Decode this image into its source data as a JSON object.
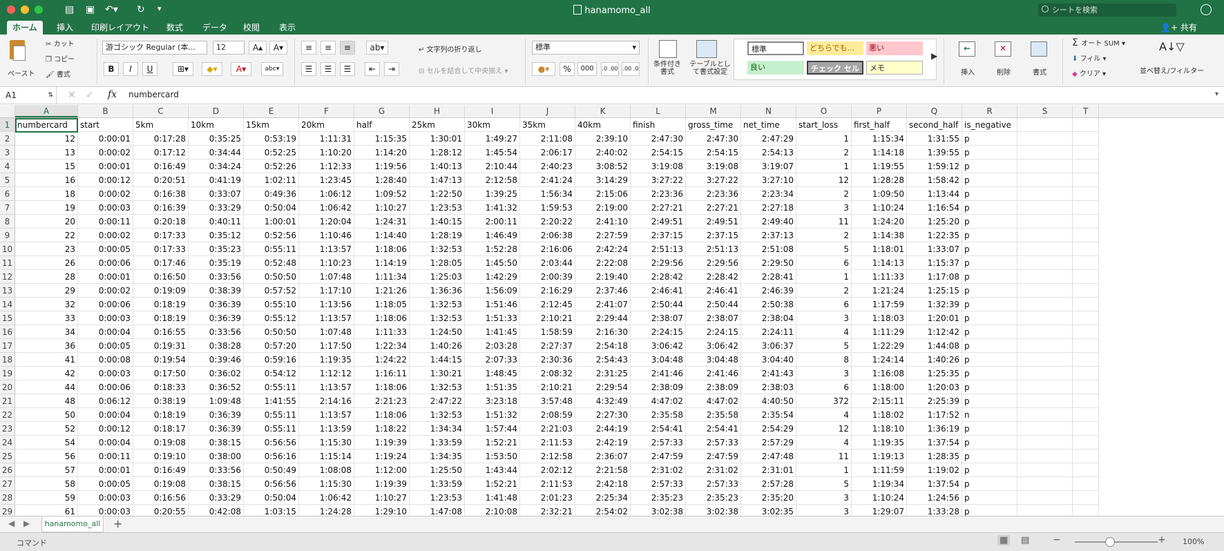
{
  "window": {
    "title": "hanamomo_all"
  },
  "search": {
    "placeholder": "シートを検索"
  },
  "tabs": [
    "ホーム",
    "挿入",
    "印刷レイアウト",
    "数式",
    "データ",
    "校閲",
    "表示"
  ],
  "share_label": "共有",
  "ribbon": {
    "paste": "ペースト",
    "cut": "カット",
    "copy": "コピー",
    "format_painter": "書式",
    "font_name": "游ゴシック Regular (本...",
    "font_size": "12",
    "bold": "B",
    "italic": "I",
    "underline": "U",
    "wrap_text": "文字列の折り返し",
    "merge_center": "セルを結合して中央揃え",
    "number_format": "標準",
    "percent": "%",
    "comma": "000",
    "dec_inc": ".0 .00",
    "dec_dec": ".00 .0",
    "conditional_format": "条件付き\n書式",
    "table_format": "テーブルとして書式設定",
    "styles": [
      "標準",
      "どちらでも...",
      "悪い",
      "良い",
      "チェック セル",
      "メモ"
    ],
    "insert": "挿入",
    "delete": "削除",
    "format": "書式",
    "autosum": "オート SUM",
    "fill": "フィル",
    "clear": "クリア",
    "sort_filter": "並べ替え/フィルター"
  },
  "formula_bar": {
    "name_box": "A1",
    "fx": "fx",
    "value": "numbercard"
  },
  "columns": [
    "A",
    "B",
    "C",
    "D",
    "E",
    "F",
    "G",
    "H",
    "I",
    "J",
    "K",
    "L",
    "M",
    "N",
    "O",
    "P",
    "Q",
    "R",
    "S",
    "T"
  ],
  "row_numbers": [
    1,
    2,
    3,
    4,
    5,
    6,
    7,
    8,
    9,
    10,
    11,
    12,
    13,
    14,
    15,
    16,
    17,
    18,
    19,
    20,
    21,
    22,
    23,
    24,
    25,
    26,
    27,
    28,
    29
  ],
  "headers": [
    "numbercard",
    "start",
    "5km",
    "10km",
    "15km",
    "20km",
    "half",
    "25km",
    "30km",
    "35km",
    "40km",
    "finish",
    "gross_time",
    "net_time",
    "start_loss",
    "first_half",
    "second_half",
    "is_negative"
  ],
  "rows": [
    [
      "12",
      "0:00:01",
      "0:17:28",
      "0:35:25",
      "0:53:19",
      "1:11:31",
      "1:15:35",
      "1:30:01",
      "1:49:27",
      "2:11:08",
      "2:39:10",
      "2:47:30",
      "2:47:30",
      "2:47:29",
      "1",
      "1:15:34",
      "1:31:55",
      "p"
    ],
    [
      "13",
      "0:00:02",
      "0:17:12",
      "0:34:44",
      "0:52:25",
      "1:10:20",
      "1:14:20",
      "1:28:12",
      "1:45:54",
      "2:06:17",
      "2:40:02",
      "2:54:15",
      "2:54:15",
      "2:54:13",
      "2",
      "1:14:18",
      "1:39:55",
      "p"
    ],
    [
      "15",
      "0:00:01",
      "0:16:49",
      "0:34:24",
      "0:52:26",
      "1:12:33",
      "1:19:56",
      "1:40:13",
      "2:10:44",
      "2:40:23",
      "3:08:52",
      "3:19:08",
      "3:19:08",
      "3:19:07",
      "1",
      "1:19:55",
      "1:59:12",
      "p"
    ],
    [
      "16",
      "0:00:12",
      "0:20:51",
      "0:41:19",
      "1:02:11",
      "1:23:45",
      "1:28:40",
      "1:47:13",
      "2:12:58",
      "2:41:24",
      "3:14:29",
      "3:27:22",
      "3:27:22",
      "3:27:10",
      "12",
      "1:28:28",
      "1:58:42",
      "p"
    ],
    [
      "18",
      "0:00:02",
      "0:16:38",
      "0:33:07",
      "0:49:36",
      "1:06:12",
      "1:09:52",
      "1:22:50",
      "1:39:25",
      "1:56:34",
      "2:15:06",
      "2:23:36",
      "2:23:36",
      "2:23:34",
      "2",
      "1:09:50",
      "1:13:44",
      "p"
    ],
    [
      "19",
      "0:00:03",
      "0:16:39",
      "0:33:29",
      "0:50:04",
      "1:06:42",
      "1:10:27",
      "1:23:53",
      "1:41:32",
      "1:59:53",
      "2:19:00",
      "2:27:21",
      "2:27:21",
      "2:27:18",
      "3",
      "1:10:24",
      "1:16:54",
      "p"
    ],
    [
      "20",
      "0:00:11",
      "0:20:18",
      "0:40:11",
      "1:00:01",
      "1:20:04",
      "1:24:31",
      "1:40:15",
      "2:00:11",
      "2:20:22",
      "2:41:10",
      "2:49:51",
      "2:49:51",
      "2:49:40",
      "11",
      "1:24:20",
      "1:25:20",
      "p"
    ],
    [
      "22",
      "0:00:02",
      "0:17:33",
      "0:35:12",
      "0:52:56",
      "1:10:46",
      "1:14:40",
      "1:28:19",
      "1:46:49",
      "2:06:38",
      "2:27:59",
      "2:37:15",
      "2:37:15",
      "2:37:13",
      "2",
      "1:14:38",
      "1:22:35",
      "p"
    ],
    [
      "23",
      "0:00:05",
      "0:17:33",
      "0:35:23",
      "0:55:11",
      "1:13:57",
      "1:18:06",
      "1:32:53",
      "1:52:28",
      "2:16:06",
      "2:42:24",
      "2:51:13",
      "2:51:13",
      "2:51:08",
      "5",
      "1:18:01",
      "1:33:07",
      "p"
    ],
    [
      "26",
      "0:00:06",
      "0:17:46",
      "0:35:19",
      "0:52:48",
      "1:10:23",
      "1:14:19",
      "1:28:05",
      "1:45:50",
      "2:03:44",
      "2:22:08",
      "2:29:56",
      "2:29:56",
      "2:29:50",
      "6",
      "1:14:13",
      "1:15:37",
      "p"
    ],
    [
      "28",
      "0:00:01",
      "0:16:50",
      "0:33:56",
      "0:50:50",
      "1:07:48",
      "1:11:34",
      "1:25:03",
      "1:42:29",
      "2:00:39",
      "2:19:40",
      "2:28:42",
      "2:28:42",
      "2:28:41",
      "1",
      "1:11:33",
      "1:17:08",
      "p"
    ],
    [
      "29",
      "0:00:02",
      "0:19:09",
      "0:38:39",
      "0:57:52",
      "1:17:10",
      "1:21:26",
      "1:36:36",
      "1:56:09",
      "2:16:29",
      "2:37:46",
      "2:46:41",
      "2:46:41",
      "2:46:39",
      "2",
      "1:21:24",
      "1:25:15",
      "p"
    ],
    [
      "32",
      "0:00:06",
      "0:18:19",
      "0:36:39",
      "0:55:10",
      "1:13:56",
      "1:18:05",
      "1:32:53",
      "1:51:46",
      "2:12:45",
      "2:41:07",
      "2:50:44",
      "2:50:44",
      "2:50:38",
      "6",
      "1:17:59",
      "1:32:39",
      "p"
    ],
    [
      "33",
      "0:00:03",
      "0:18:19",
      "0:36:39",
      "0:55:12",
      "1:13:57",
      "1:18:06",
      "1:32:53",
      "1:51:33",
      "2:10:21",
      "2:29:44",
      "2:38:07",
      "2:38:07",
      "2:38:04",
      "3",
      "1:18:03",
      "1:20:01",
      "p"
    ],
    [
      "34",
      "0:00:04",
      "0:16:55",
      "0:33:56",
      "0:50:50",
      "1:07:48",
      "1:11:33",
      "1:24:50",
      "1:41:45",
      "1:58:59",
      "2:16:30",
      "2:24:15",
      "2:24:15",
      "2:24:11",
      "4",
      "1:11:29",
      "1:12:42",
      "p"
    ],
    [
      "36",
      "0:00:05",
      "0:19:31",
      "0:38:28",
      "0:57:20",
      "1:17:50",
      "1:22:34",
      "1:40:26",
      "2:03:28",
      "2:27:37",
      "2:54:18",
      "3:06:42",
      "3:06:42",
      "3:06:37",
      "5",
      "1:22:29",
      "1:44:08",
      "p"
    ],
    [
      "41",
      "0:00:08",
      "0:19:54",
      "0:39:46",
      "0:59:16",
      "1:19:35",
      "1:24:22",
      "1:44:15",
      "2:07:33",
      "2:30:36",
      "2:54:43",
      "3:04:48",
      "3:04:48",
      "3:04:40",
      "8",
      "1:24:14",
      "1:40:26",
      "p"
    ],
    [
      "42",
      "0:00:03",
      "0:17:50",
      "0:36:02",
      "0:54:12",
      "1:12:12",
      "1:16:11",
      "1:30:21",
      "1:48:45",
      "2:08:32",
      "2:31:25",
      "2:41:46",
      "2:41:46",
      "2:41:43",
      "3",
      "1:16:08",
      "1:25:35",
      "p"
    ],
    [
      "44",
      "0:00:06",
      "0:18:33",
      "0:36:52",
      "0:55:11",
      "1:13:57",
      "1:18:06",
      "1:32:53",
      "1:51:35",
      "2:10:21",
      "2:29:54",
      "2:38:09",
      "2:38:09",
      "2:38:03",
      "6",
      "1:18:00",
      "1:20:03",
      "p"
    ],
    [
      "48",
      "0:06:12",
      "0:38:19",
      "1:09:48",
      "1:41:55",
      "2:14:16",
      "2:21:23",
      "2:47:22",
      "3:23:18",
      "3:57:48",
      "4:32:49",
      "4:47:02",
      "4:47:02",
      "4:40:50",
      "372",
      "2:15:11",
      "2:25:39",
      "p"
    ],
    [
      "50",
      "0:00:04",
      "0:18:19",
      "0:36:39",
      "0:55:11",
      "1:13:57",
      "1:18:06",
      "1:32:53",
      "1:51:32",
      "2:08:59",
      "2:27:30",
      "2:35:58",
      "2:35:58",
      "2:35:54",
      "4",
      "1:18:02",
      "1:17:52",
      "n"
    ],
    [
      "52",
      "0:00:12",
      "0:18:17",
      "0:36:39",
      "0:55:11",
      "1:13:59",
      "1:18:22",
      "1:34:34",
      "1:57:44",
      "2:21:03",
      "2:44:19",
      "2:54:41",
      "2:54:41",
      "2:54:29",
      "12",
      "1:18:10",
      "1:36:19",
      "p"
    ],
    [
      "54",
      "0:00:04",
      "0:19:08",
      "0:38:15",
      "0:56:56",
      "1:15:30",
      "1:19:39",
      "1:33:59",
      "1:52:21",
      "2:11:53",
      "2:42:19",
      "2:57:33",
      "2:57:33",
      "2:57:29",
      "4",
      "1:19:35",
      "1:37:54",
      "p"
    ],
    [
      "56",
      "0:00:11",
      "0:19:10",
      "0:38:00",
      "0:56:16",
      "1:15:14",
      "1:19:24",
      "1:34:35",
      "1:53:50",
      "2:12:58",
      "2:36:07",
      "2:47:59",
      "2:47:59",
      "2:47:48",
      "11",
      "1:19:13",
      "1:28:35",
      "p"
    ],
    [
      "57",
      "0:00:01",
      "0:16:49",
      "0:33:56",
      "0:50:49",
      "1:08:08",
      "1:12:00",
      "1:25:50",
      "1:43:44",
      "2:02:12",
      "2:21:58",
      "2:31:02",
      "2:31:02",
      "2:31:01",
      "1",
      "1:11:59",
      "1:19:02",
      "p"
    ],
    [
      "58",
      "0:00:05",
      "0:19:08",
      "0:38:15",
      "0:56:56",
      "1:15:30",
      "1:19:39",
      "1:33:59",
      "1:52:21",
      "2:11:53",
      "2:42:18",
      "2:57:33",
      "2:57:33",
      "2:57:28",
      "5",
      "1:19:34",
      "1:37:54",
      "p"
    ],
    [
      "59",
      "0:00:03",
      "0:16:56",
      "0:33:29",
      "0:50:04",
      "1:06:42",
      "1:10:27",
      "1:23:53",
      "1:41:48",
      "2:01:23",
      "2:25:34",
      "2:35:23",
      "2:35:23",
      "2:35:20",
      "3",
      "1:10:24",
      "1:24:56",
      "p"
    ],
    [
      "61",
      "0:00:03",
      "0:20:55",
      "0:42:08",
      "1:03:15",
      "1:24:28",
      "1:29:10",
      "1:47:08",
      "2:10:08",
      "2:32:21",
      "2:54:02",
      "3:02:38",
      "3:02:38",
      "3:02:35",
      "3",
      "1:29:07",
      "1:33:28",
      "p"
    ]
  ],
  "sheet_tab": "hanamomo_all",
  "status": {
    "mode": "コマンド",
    "zoom": "100%"
  }
}
